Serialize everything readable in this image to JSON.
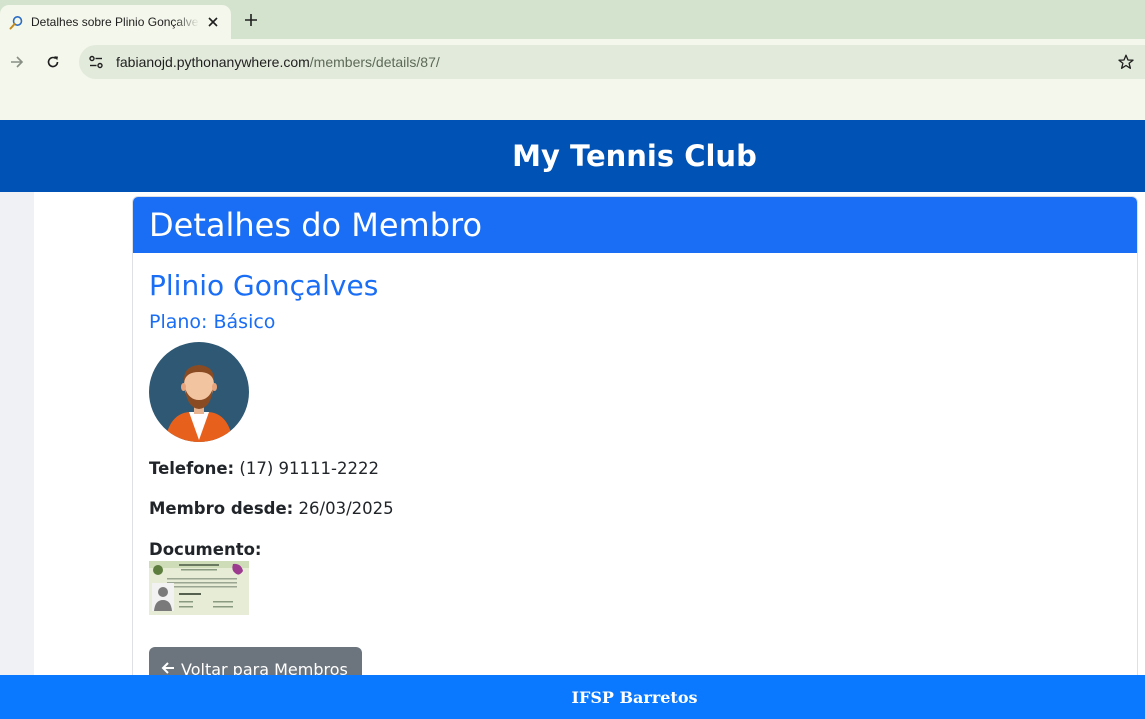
{
  "browser": {
    "tab_title": "Detalhes sobre Plinio Gonçalves",
    "url_host": "fabianojd.pythonanywhere.com",
    "url_path": "/members/details/87/"
  },
  "site": {
    "title": "My Tennis Club",
    "footer": "IFSP Barretos"
  },
  "card": {
    "header": "Detalhes do Membro",
    "name": "Plinio Gonçalves",
    "plan": "Plano: Básico",
    "phone_label": "Telefone:",
    "phone_value": "(17) 91111-2222",
    "since_label": "Membro desde:",
    "since_value": "26/03/2025",
    "document_label": "Documento:",
    "back_label": "Voltar para Membros"
  },
  "colors": {
    "header_bg": "#0052b4",
    "card_header_bg": "#1a6ef5",
    "footer_bg": "#0a78ff",
    "button_bg": "#6c757d"
  },
  "icons": [
    "tennis-racket-favicon-icon",
    "close-icon",
    "plus-icon",
    "arrow-right-icon",
    "reload-icon",
    "site-settings-icon",
    "star-icon",
    "arrow-left-icon"
  ]
}
